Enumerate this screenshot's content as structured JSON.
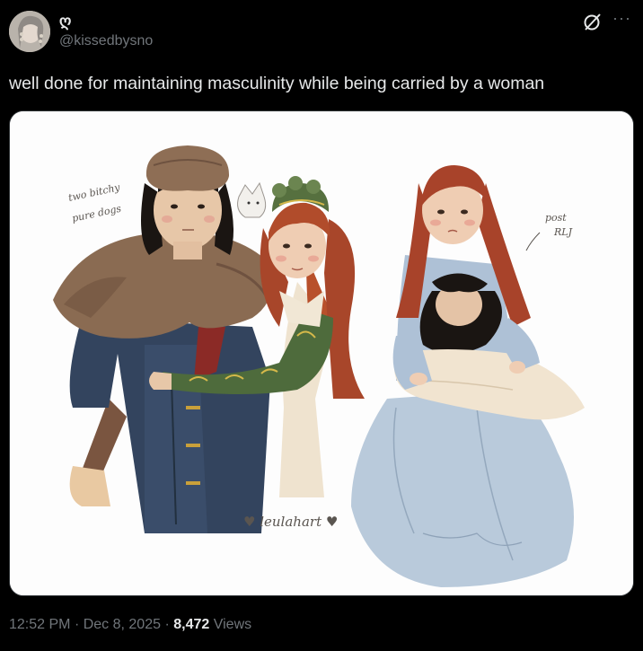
{
  "author": {
    "display_name": "ღ",
    "handle": "@kissedbysno",
    "avatar_icon": "avatar-photo"
  },
  "header_icons": [
    "grok-icon",
    "more-icon"
  ],
  "more_label": "···",
  "tweet": {
    "text": "well done for maintaining masculinity while being carried by a woman"
  },
  "media": {
    "annotations": {
      "left_note": "two bitchy\npure dogs",
      "right_note": "post\nRLJ",
      "signature": "♥ leulahart ♥"
    }
  },
  "meta": {
    "time": "12:52 PM",
    "sep1": "·",
    "date": "Dec 8, 2025",
    "sep2": "·",
    "views_count": "8,472",
    "views_label": "Views"
  },
  "colors": {
    "background": "#000000",
    "text_primary": "#e7e9ea",
    "text_secondary": "#71767b",
    "media_bg": "#fdfdfd"
  }
}
